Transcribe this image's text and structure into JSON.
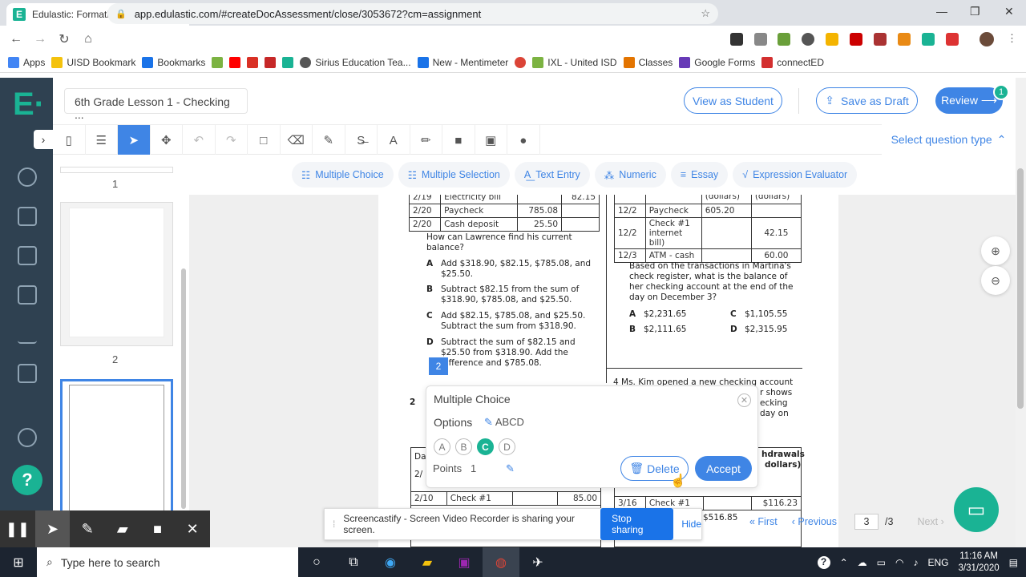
{
  "browser": {
    "tab_title": "Edulastic: Formative and Summati",
    "tab_close": "✕",
    "new_tab": "+",
    "url": "app.edulastic.com/#createDocAssessment/close/3053672?cm=assignment",
    "bookmarks": [
      "Apps",
      "UISD Bookmark",
      "Bookmarks",
      "",
      "",
      "",
      "",
      "",
      "Sirius Education Tea...",
      "New - Mentimeter",
      "",
      "IXL - United ISD",
      "Classes",
      "Google Forms",
      "connectED"
    ]
  },
  "header": {
    "doc_name": "6th Grade Lesson 1 - Checking ...",
    "view_as_student": "View as Student",
    "save_as_draft": "Save as Draft",
    "review": "Review ⟶",
    "review_badge": "1"
  },
  "toolbar": {
    "select_question_type": "Select question type"
  },
  "question_types": [
    "Multiple Choice",
    "Multiple Selection",
    "Text Entry",
    "Numeric",
    "Essay",
    "Expression Evaluator"
  ],
  "thumbnails": {
    "page1": "1",
    "page2": "2"
  },
  "doc": {
    "left_table": [
      [
        "2/19",
        "Electricity bill",
        "",
        "82.15"
      ],
      [
        "2/20",
        "Paycheck",
        "785.08",
        ""
      ],
      [
        "2/20",
        "Cash deposit",
        "25.50",
        ""
      ]
    ],
    "q_text": "How can Lawrence find his current balance?",
    "answers": [
      [
        "A",
        "Add $318.90, $82.15, $785.08, and $25.50."
      ],
      [
        "B",
        "Subtract $82.15 from the sum of $318.90, $785.08, and $25.50."
      ],
      [
        "C",
        "Add $82.15, $785.08, and $25.50. Subtract the sum from $318.90."
      ],
      [
        "D",
        "Subtract the sum of $82.15 and $25.50 from $318.90. Add the difference and $785.08."
      ]
    ],
    "right_header": [
      "(dollars)",
      "(dollars)"
    ],
    "right_table": [
      [
        "12/2",
        "Paycheck",
        "605.20",
        ""
      ],
      [
        "12/2",
        "Check #1 internet bill)",
        "",
        "42.15"
      ],
      [
        "12/3",
        "ATM - cash",
        "",
        "60.00"
      ]
    ],
    "q3_text": "Based on the transactions in Martina's check register, what is the balance of her checking account at the end of the day on December 3?",
    "q3_answers": [
      [
        "A",
        "$2,231.65"
      ],
      [
        "C",
        "$1,105.55"
      ],
      [
        "B",
        "$2,111.65"
      ],
      [
        "D",
        "$2,315.95"
      ]
    ],
    "q4_start": "4  Ms. Kim opened a new checking account",
    "q4_frag": [
      "r shows",
      "ecking",
      "day on"
    ],
    "q2_label": "2",
    "bottom_left": [
      [
        "2/10",
        "Check #1",
        "",
        "85.00"
      ]
    ],
    "bottom_right": [
      [
        "3/16",
        "Check #1",
        "",
        "$116.23"
      ]
    ],
    "withdrawals": "hdrawals",
    "dollars": "dollars)",
    "frag_516": "$516.85",
    "frag_da": "Da",
    "frag_2": "2/"
  },
  "question_marker": "2",
  "mc_popup": {
    "title": "Multiple Choice",
    "options_label": "Options",
    "options_value": "ABCD",
    "choices": [
      "A",
      "B",
      "C",
      "D"
    ],
    "selected": "C",
    "points_label": "Points",
    "points_value": "1",
    "delete": "Delete",
    "accept": "Accept"
  },
  "pager": {
    "first": "« First",
    "previous": "‹ Previous",
    "page": "3",
    "total": "/3",
    "next": "Next ›"
  },
  "screencastify": {
    "message": "Screencastify - Screen Video Recorder is sharing your screen.",
    "stop": "Stop sharing",
    "hide": "Hide"
  },
  "taskbar": {
    "search": "Type here to search",
    "lang": "ENG",
    "time": "11:16 AM",
    "date": "3/31/2020"
  },
  "colors": {
    "brand": "#1ab394",
    "accent": "#3f85e5",
    "sidebar": "#2f4151"
  }
}
